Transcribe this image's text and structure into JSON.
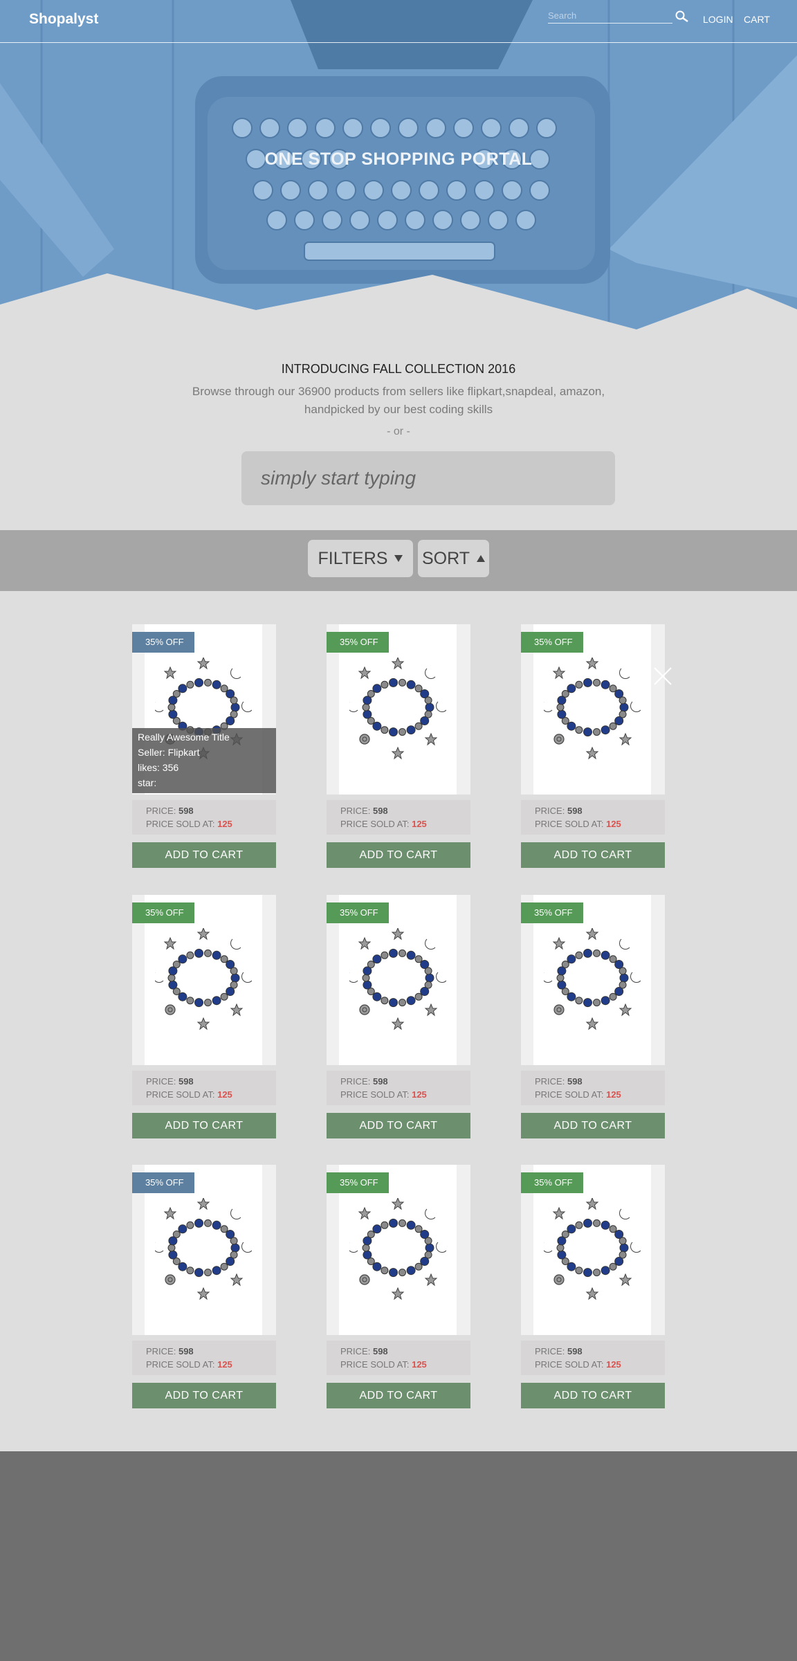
{
  "nav": {
    "brand": "Shopalyst",
    "search_placeholder": "Search",
    "login": "LOGIN",
    "cart": "CART"
  },
  "hero": {
    "title": "ONE STOP SHOPPING PORTAL"
  },
  "intro": {
    "heading": "INTRODUCING FALL COLLECTION 2016",
    "description": "Browse through our 36900 products from sellers like flipkart,snapdeal, amazon, handpicked by our best coding skills",
    "or": "- or -",
    "search_placeholder": "simply start typing"
  },
  "toolbar": {
    "filters": "FILTERS",
    "sort": "SORT"
  },
  "products": [
    {
      "badge": "35% OFF",
      "badge_color": "#5d7fa0",
      "price_label": "PRICE:",
      "price": "598",
      "sold_label": "PRICE SOLD AT:",
      "sold": "125",
      "button": "ADD TO CART",
      "hover": {
        "title": "Really Awesome Title",
        "seller": "Seller: Flipkart",
        "likes": "likes: 356",
        "star": "star:"
      }
    },
    {
      "badge": "35% OFF",
      "badge_color": "#559a56",
      "price_label": "PRICE:",
      "price": "598",
      "sold_label": "PRICE SOLD AT:",
      "sold": "125",
      "button": "ADD TO CART"
    },
    {
      "badge": "35% OFF",
      "badge_color": "#559a56",
      "price_label": "PRICE:",
      "price": "598",
      "sold_label": "PRICE SOLD AT:",
      "sold": "125",
      "button": "ADD TO CART"
    },
    {
      "badge": "35% OFF",
      "badge_color": "#559a56",
      "price_label": "PRICE:",
      "price": "598",
      "sold_label": "PRICE SOLD AT:",
      "sold": "125",
      "button": "ADD TO CART"
    },
    {
      "badge": "35% OFF",
      "badge_color": "#559a56",
      "price_label": "PRICE:",
      "price": "598",
      "sold_label": "PRICE SOLD AT:",
      "sold": "125",
      "button": "ADD TO CART"
    },
    {
      "badge": "35% OFF",
      "badge_color": "#559a56",
      "price_label": "PRICE:",
      "price": "598",
      "sold_label": "PRICE SOLD AT:",
      "sold": "125",
      "button": "ADD TO CART"
    },
    {
      "badge": "35% OFF",
      "badge_color": "#5d7fa0",
      "price_label": "PRICE:",
      "price": "598",
      "sold_label": "PRICE SOLD AT:",
      "sold": "125",
      "button": "ADD TO CART"
    },
    {
      "badge": "35% OFF",
      "badge_color": "#559a56",
      "price_label": "PRICE:",
      "price": "598",
      "sold_label": "PRICE SOLD AT:",
      "sold": "125",
      "button": "ADD TO CART"
    },
    {
      "badge": "35% OFF",
      "badge_color": "#559a56",
      "price_label": "PRICE:",
      "price": "598",
      "sold_label": "PRICE SOLD AT:",
      "sold": "125",
      "button": "ADD TO CART"
    }
  ],
  "icons": {
    "search": "search-icon",
    "close": "close-icon",
    "filters_caret": "caret-down-icon",
    "sort_caret": "caret-up-icon",
    "product_image": "bracelet-image"
  },
  "colors": {
    "hero_blue": "#6f9cc7",
    "badge_blue": "#5d7fa0",
    "badge_green": "#559a56",
    "add_to_cart": "#6c8f6d",
    "sold_price": "#d9534f",
    "filter_bar": "#a6a6a6",
    "footer": "#6f6f6f"
  }
}
